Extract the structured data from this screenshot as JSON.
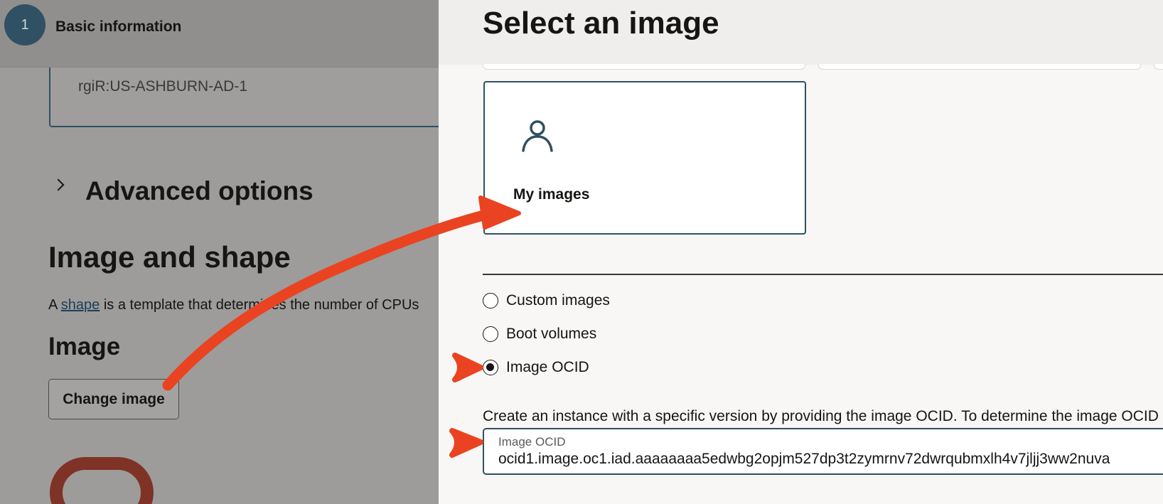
{
  "left": {
    "step_number": "1",
    "step_label": "Basic information",
    "availability_domain": "rgiR:US-ASHBURN-AD-1",
    "advanced_options": "Advanced options",
    "image_and_shape_title": "Image and shape",
    "shape_desc_prefix": "A ",
    "shape_link": "shape",
    "shape_desc_suffix": " is a template that determines the number of CPUs",
    "image_title": "Image",
    "change_image_button": "Change image"
  },
  "panel": {
    "title": "Select an image",
    "card_label": "My images",
    "radio_options": [
      "Custom images",
      "Boot volumes",
      "Image OCID"
    ],
    "selected_option": "Image OCID",
    "help_text": "Create an instance with a specific version by providing the image OCID. To determine the image OCID",
    "ocid_label": "Image OCID",
    "ocid_value": "ocid1.image.oc1.iad.aaaaaaaa5edwbg2opjm527dp3t2zymrnv72dwrqubmxlh4v7jljj3ww2nuva"
  },
  "colors": {
    "accent": "#2f5163",
    "annotation": "#ea4321",
    "overlay_dim": "#9d9c9a"
  },
  "icons": {
    "step": "step-number-circle",
    "card": "person-icon",
    "advanced": "chevron-right-icon",
    "annotation": "red-arrow"
  }
}
